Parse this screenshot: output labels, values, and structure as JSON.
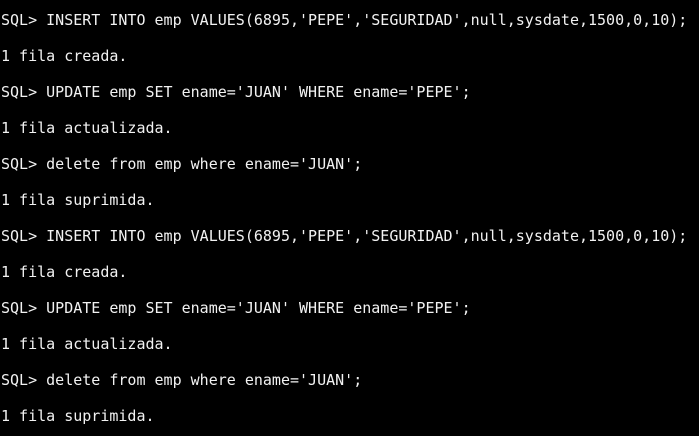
{
  "terminal": {
    "lines": [
      "SQL> INSERT INTO emp VALUES(6895,'PEPE','SEGURIDAD',null,sysdate,1500,0,10);",
      "1 fila creada.",
      "SQL> UPDATE emp SET ename='JUAN' WHERE ename='PEPE';",
      "1 fila actualizada.",
      "SQL> delete from emp where ename='JUAN';",
      "1 fila suprimida.",
      "SQL> INSERT INTO emp VALUES(6895,'PEPE','SEGURIDAD',null,sysdate,1500,0,10);",
      "1 fila creada.",
      "SQL> UPDATE emp SET ename='JUAN' WHERE ename='PEPE';",
      "1 fila actualizada.",
      "SQL> delete from emp where ename='JUAN';",
      "1 fila suprimida."
    ]
  },
  "colors": {
    "background": "#000000",
    "text": "#f2f2f2"
  }
}
